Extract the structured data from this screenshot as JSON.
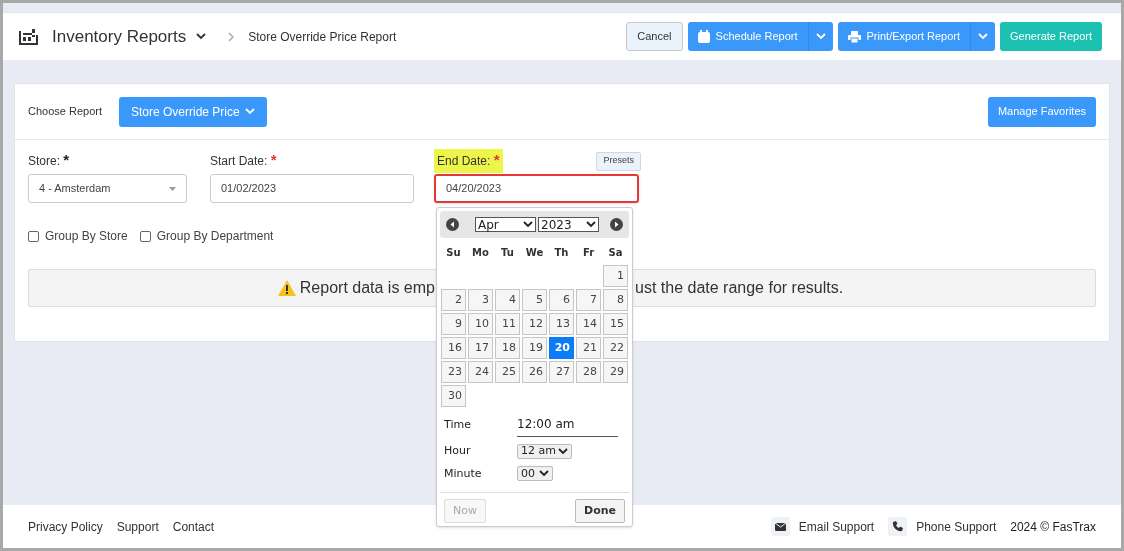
{
  "header": {
    "title": "Inventory Reports",
    "breadcrumb": "Store Override Price Report",
    "buttons": [
      {
        "label": "Cancel",
        "kind": "plain"
      },
      {
        "label": "Schedule Report",
        "kind": "split"
      },
      {
        "label": "Print/Export Report",
        "kind": "split"
      },
      {
        "label": "Generate Report",
        "kind": "success"
      }
    ]
  },
  "report": {
    "choose_label": "Choose Report",
    "choose_value": "Store Override Price",
    "favorites_button": "Manage Favorites"
  },
  "fields": [
    {
      "label": "Store:",
      "required_mark": "*",
      "color": "#222222",
      "kind": "select",
      "value": "4 - Amsterdam",
      "highlighted": false,
      "focused": false
    },
    {
      "label": "Start Date:",
      "required_mark": "*",
      "color": "#e53935",
      "kind": "text",
      "value": "01/02/2023",
      "highlighted": false,
      "focused": false
    },
    {
      "label": "End Date:",
      "required_mark": "*",
      "color": "#e53935",
      "kind": "text",
      "value": "04/20/2023",
      "highlighted": true,
      "focused": true
    }
  ],
  "presets_button": "Presets",
  "checkboxes": [
    {
      "label": "Group By Store",
      "checked": false
    },
    {
      "label": "Group By Department",
      "checked": false
    }
  ],
  "alert": {
    "text_before": "Report data is emp",
    "text_after": "ust the date range for results."
  },
  "calendar": {
    "month": "Apr",
    "year": "2023",
    "weekdays": [
      "Su",
      "Mo",
      "Tu",
      "We",
      "Th",
      "Fr",
      "Sa"
    ],
    "weeks": [
      {
        "days": [
          {
            "day": "1",
            "selected": false
          }
        ]
      },
      {
        "days": [
          {
            "day": "2",
            "selected": false
          },
          {
            "day": "3",
            "selected": false
          },
          {
            "day": "4",
            "selected": false
          },
          {
            "day": "5",
            "selected": false
          },
          {
            "day": "6",
            "selected": false
          },
          {
            "day": "7",
            "selected": false
          },
          {
            "day": "8",
            "selected": false
          }
        ]
      },
      {
        "days": [
          {
            "day": "9",
            "selected": false
          },
          {
            "day": "10",
            "selected": false
          },
          {
            "day": "11",
            "selected": false
          },
          {
            "day": "12",
            "selected": false
          },
          {
            "day": "13",
            "selected": false
          },
          {
            "day": "14",
            "selected": false
          },
          {
            "day": "15",
            "selected": false
          }
        ]
      },
      {
        "days": [
          {
            "day": "16",
            "selected": false
          },
          {
            "day": "17",
            "selected": false
          },
          {
            "day": "18",
            "selected": false
          },
          {
            "day": "19",
            "selected": false
          },
          {
            "day": "20",
            "selected": true
          },
          {
            "day": "21",
            "selected": false
          },
          {
            "day": "22",
            "selected": false
          }
        ]
      },
      {
        "days": [
          {
            "day": "23",
            "selected": false
          },
          {
            "day": "24",
            "selected": false
          },
          {
            "day": "25",
            "selected": false
          },
          {
            "day": "26",
            "selected": false
          },
          {
            "day": "27",
            "selected": false
          },
          {
            "day": "28",
            "selected": false
          },
          {
            "day": "29",
            "selected": false
          }
        ]
      },
      {
        "days": [
          {
            "day": "30",
            "selected": false
          }
        ]
      }
    ],
    "time_label": "Time",
    "time_value": "12:00 am",
    "hour_label": "Hour",
    "hour_value": "12 am",
    "minute_label": "Minute",
    "minute_value": "00",
    "buttons": [
      {
        "label": "Now",
        "disabled": true
      },
      {
        "label": "Done",
        "disabled": false
      }
    ]
  },
  "footer": {
    "links": [
      "Privacy Policy",
      "Support",
      "Contact"
    ],
    "support": [
      {
        "label": "Email Support"
      },
      {
        "label": "Phone Support"
      }
    ],
    "copyright": "2024 © FasTrax"
  }
}
